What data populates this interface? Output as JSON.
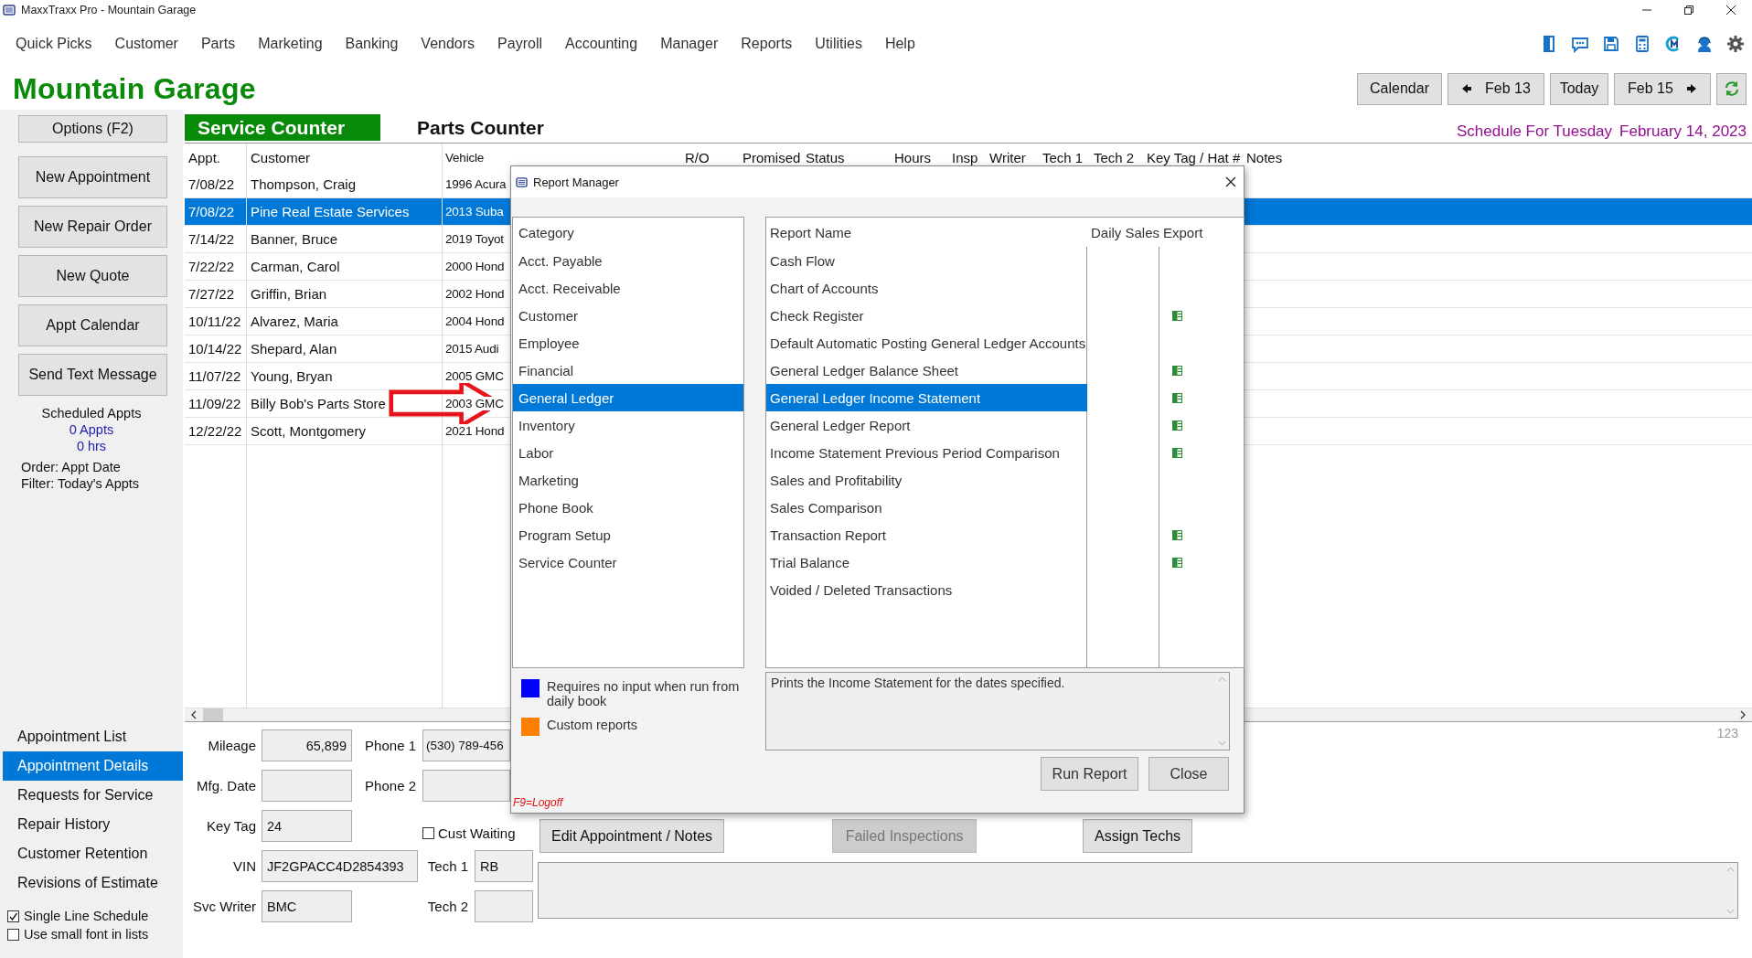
{
  "window": {
    "title": "MaxxTraxx Pro - Mountain Garage"
  },
  "menu": [
    "Quick Picks",
    "Customer",
    "Parts",
    "Marketing",
    "Banking",
    "Vendors",
    "Payroll",
    "Accounting",
    "Manager",
    "Reports",
    "Utilities",
    "Help"
  ],
  "shop_name": "Mountain Garage",
  "date_nav": {
    "calendar": "Calendar",
    "prev": "Feb 13",
    "today": "Today",
    "next": "Feb 15"
  },
  "sidebar": {
    "options": "Options (F2)",
    "actions": [
      "New Appointment",
      "New Repair Order",
      "New Quote",
      "Appt Calendar",
      "Send Text Message"
    ],
    "summary": {
      "label": "Scheduled Appts",
      "appts": "0 Appts",
      "hours": "0 hrs",
      "order": "Order: Appt Date",
      "filter": "Filter: Today's Appts"
    },
    "views": [
      {
        "label": "Appointment List",
        "selected": false
      },
      {
        "label": "Appointment Details",
        "selected": true
      },
      {
        "label": "Requests for Service",
        "selected": false
      },
      {
        "label": "Repair History",
        "selected": false
      },
      {
        "label": "Customer Retention",
        "selected": false
      },
      {
        "label": "Revisions of Estimate",
        "selected": false
      }
    ],
    "checks": [
      {
        "label": "Single Line Schedule",
        "checked": true
      },
      {
        "label": "Use small font in lists",
        "checked": false
      }
    ]
  },
  "tabs": [
    {
      "label": "Service Counter",
      "selected": true
    },
    {
      "label": "Parts Counter",
      "selected": false
    }
  ],
  "schedule": {
    "day": "Schedule For Tuesday",
    "date": "February 14, 2023"
  },
  "table": {
    "columns": [
      "Appt.",
      "Customer",
      "Vehicle",
      "R/O",
      "Promised",
      "Status",
      "Hours",
      "Insp",
      "Writer",
      "Tech 1",
      "Tech 2",
      "Key Tag / Hat #",
      "Notes"
    ],
    "rows": [
      {
        "appt": "7/08/22",
        "customer": "Thompson, Craig",
        "vehicle": "1996 Acura",
        "selected": false
      },
      {
        "appt": "7/08/22",
        "customer": "Pine Real Estate Services",
        "vehicle": "2013 Suba",
        "selected": true
      },
      {
        "appt": "7/14/22",
        "customer": "Banner, Bruce",
        "vehicle": "2019 Toyot",
        "selected": false
      },
      {
        "appt": "7/22/22",
        "customer": "Carman, Carol",
        "vehicle": "2000 Hond",
        "selected": false
      },
      {
        "appt": "7/27/22",
        "customer": "Griffin, Brian",
        "vehicle": "2002 Hond",
        "selected": false
      },
      {
        "appt": "10/11/22",
        "customer": "Alvarez, Maria",
        "vehicle": "2004 Hond",
        "selected": false
      },
      {
        "appt": "10/14/22",
        "customer": "Shepard, Alan",
        "vehicle": "2015 Audi",
        "selected": false
      },
      {
        "appt": "11/07/22",
        "customer": "Young, Bryan",
        "vehicle": "2005 GMC",
        "selected": false
      },
      {
        "appt": "11/09/22",
        "customer": "Billy Bob's Parts Store",
        "vehicle": "2003 GMC",
        "selected": false
      },
      {
        "appt": "12/22/22",
        "customer": "Scott, Montgomery",
        "vehicle": "2021 Hond",
        "selected": false
      }
    ]
  },
  "record_number": "123",
  "details": {
    "fields": [
      {
        "label": "Mileage",
        "value": "65,899",
        "kind": "number"
      },
      {
        "label": "Mfg. Date",
        "kind": "text"
      },
      {
        "label": "Key Tag",
        "value": "24",
        "kind": "text"
      },
      {
        "label": "VIN",
        "value": "JF2GPACC4D2854393",
        "kind": "wide"
      },
      {
        "label": "Svc Writer",
        "value": "BMC",
        "kind": "text"
      }
    ],
    "phones": [
      {
        "label": "Phone 1",
        "value": "(530) 789-456"
      },
      {
        "label": "Phone 2"
      }
    ],
    "cust_waiting": {
      "label": "Cust Waiting",
      "checked": false
    },
    "techs": [
      {
        "label": "Tech 1",
        "value": "RB"
      },
      {
        "label": "Tech 2"
      }
    ]
  },
  "buttons": [
    {
      "label": "Edit Appointment / Notes",
      "disabled": false
    },
    {
      "label": "Failed Inspections",
      "disabled": true
    },
    {
      "label": "Assign Techs",
      "disabled": false
    }
  ],
  "report_manager": {
    "title": "Report Manager",
    "category_header": "Category",
    "categories": [
      {
        "label": "Acct. Payable",
        "selected": false
      },
      {
        "label": "Acct. Receivable",
        "selected": false
      },
      {
        "label": "Customer",
        "selected": false
      },
      {
        "label": "Employee",
        "selected": false
      },
      {
        "label": "Financial",
        "selected": false
      },
      {
        "label": "General Ledger",
        "selected": true
      },
      {
        "label": "Inventory",
        "selected": false
      },
      {
        "label": "Labor",
        "selected": false
      },
      {
        "label": "Marketing",
        "selected": false
      },
      {
        "label": "Phone Book",
        "selected": false
      },
      {
        "label": "Program Setup",
        "selected": false
      },
      {
        "label": "Service Counter",
        "selected": false
      }
    ],
    "report_columns": [
      "Report Name",
      "Daily Sales",
      "Export"
    ],
    "reports": [
      {
        "name": "Cash Flow",
        "export": false,
        "selected": false
      },
      {
        "name": "Chart of Accounts",
        "export": false,
        "selected": false
      },
      {
        "name": "Check Register",
        "export": true,
        "selected": false
      },
      {
        "name": "Default Automatic Posting General Ledger Accounts",
        "export": false,
        "selected": false
      },
      {
        "name": "General Ledger Balance Sheet",
        "export": true,
        "selected": false
      },
      {
        "name": "General Ledger Income Statement",
        "export": true,
        "selected": true
      },
      {
        "name": "General Ledger Report",
        "export": true,
        "selected": false
      },
      {
        "name": "Income Statement Previous Period Comparison",
        "export": true,
        "selected": false
      },
      {
        "name": "Sales and Profitability",
        "export": false,
        "selected": false
      },
      {
        "name": "Sales Comparison",
        "export": false,
        "selected": false
      },
      {
        "name": "Transaction Report",
        "export": true,
        "selected": false
      },
      {
        "name": "Trial Balance",
        "export": true,
        "selected": false
      },
      {
        "name": "Voided / Deleted Transactions",
        "export": false,
        "selected": false
      }
    ],
    "legend": [
      {
        "label": "Requires no input when run from daily book",
        "color": "#0000ff"
      },
      {
        "label": "Custom reports",
        "color": "#ff8000"
      }
    ],
    "description": "Prints the Income Statement for the dates specified.",
    "buttons": [
      "Run Report",
      "Close"
    ],
    "footer": "F9=Logoff"
  }
}
